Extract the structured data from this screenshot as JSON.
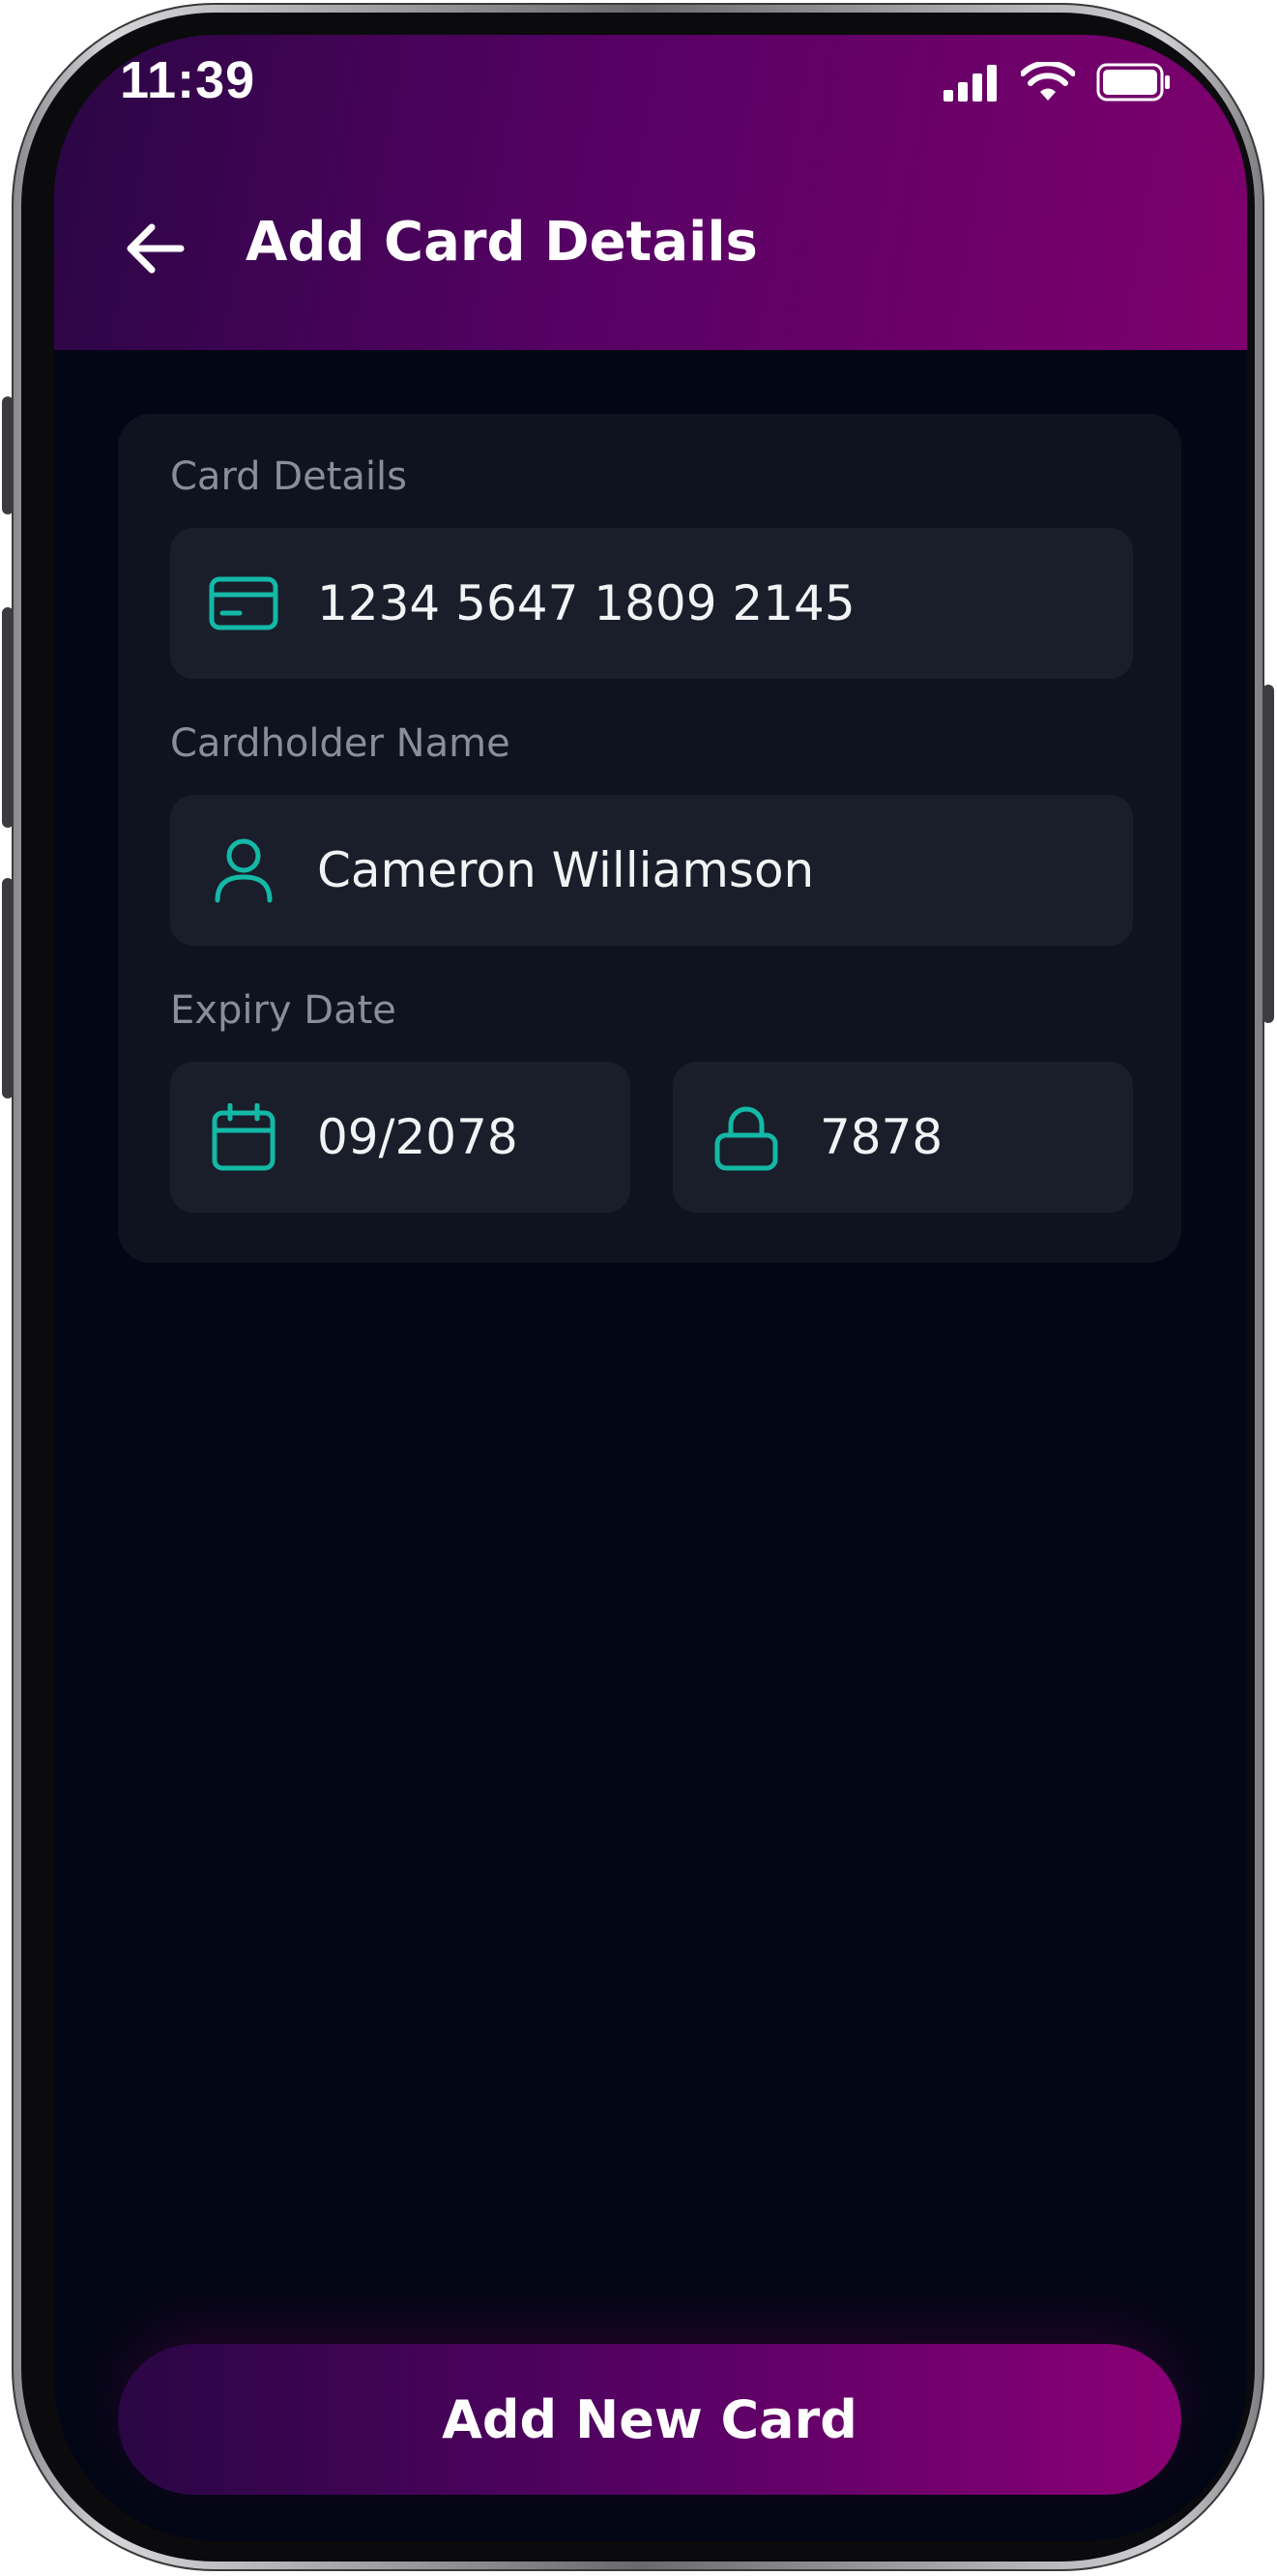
{
  "status_bar": {
    "time": "11:39",
    "icons": [
      "signal-icon",
      "wifi-icon",
      "battery-icon"
    ]
  },
  "header": {
    "title": "Add Card Details",
    "back_icon": "arrow-left-icon"
  },
  "form": {
    "card_details": {
      "label": "Card Details",
      "value": "1234 5647 1809 2145",
      "icon": "credit-card-icon"
    },
    "cardholder": {
      "label": "Cardholder Name",
      "value": "Cameron Williamson",
      "icon": "user-icon"
    },
    "expiry": {
      "label": "Expiry Date",
      "value": "09/2078",
      "icon": "calendar-icon"
    },
    "cvv": {
      "value": "7878",
      "icon": "lock-icon"
    }
  },
  "cta": {
    "label": "Add New Card"
  },
  "colors": {
    "accent": "#14b8a6",
    "gradient_start": "#2a0644",
    "gradient_end": "#7e006d",
    "background": "#030614",
    "panel": "#0e1320",
    "field": "#191e2a"
  }
}
